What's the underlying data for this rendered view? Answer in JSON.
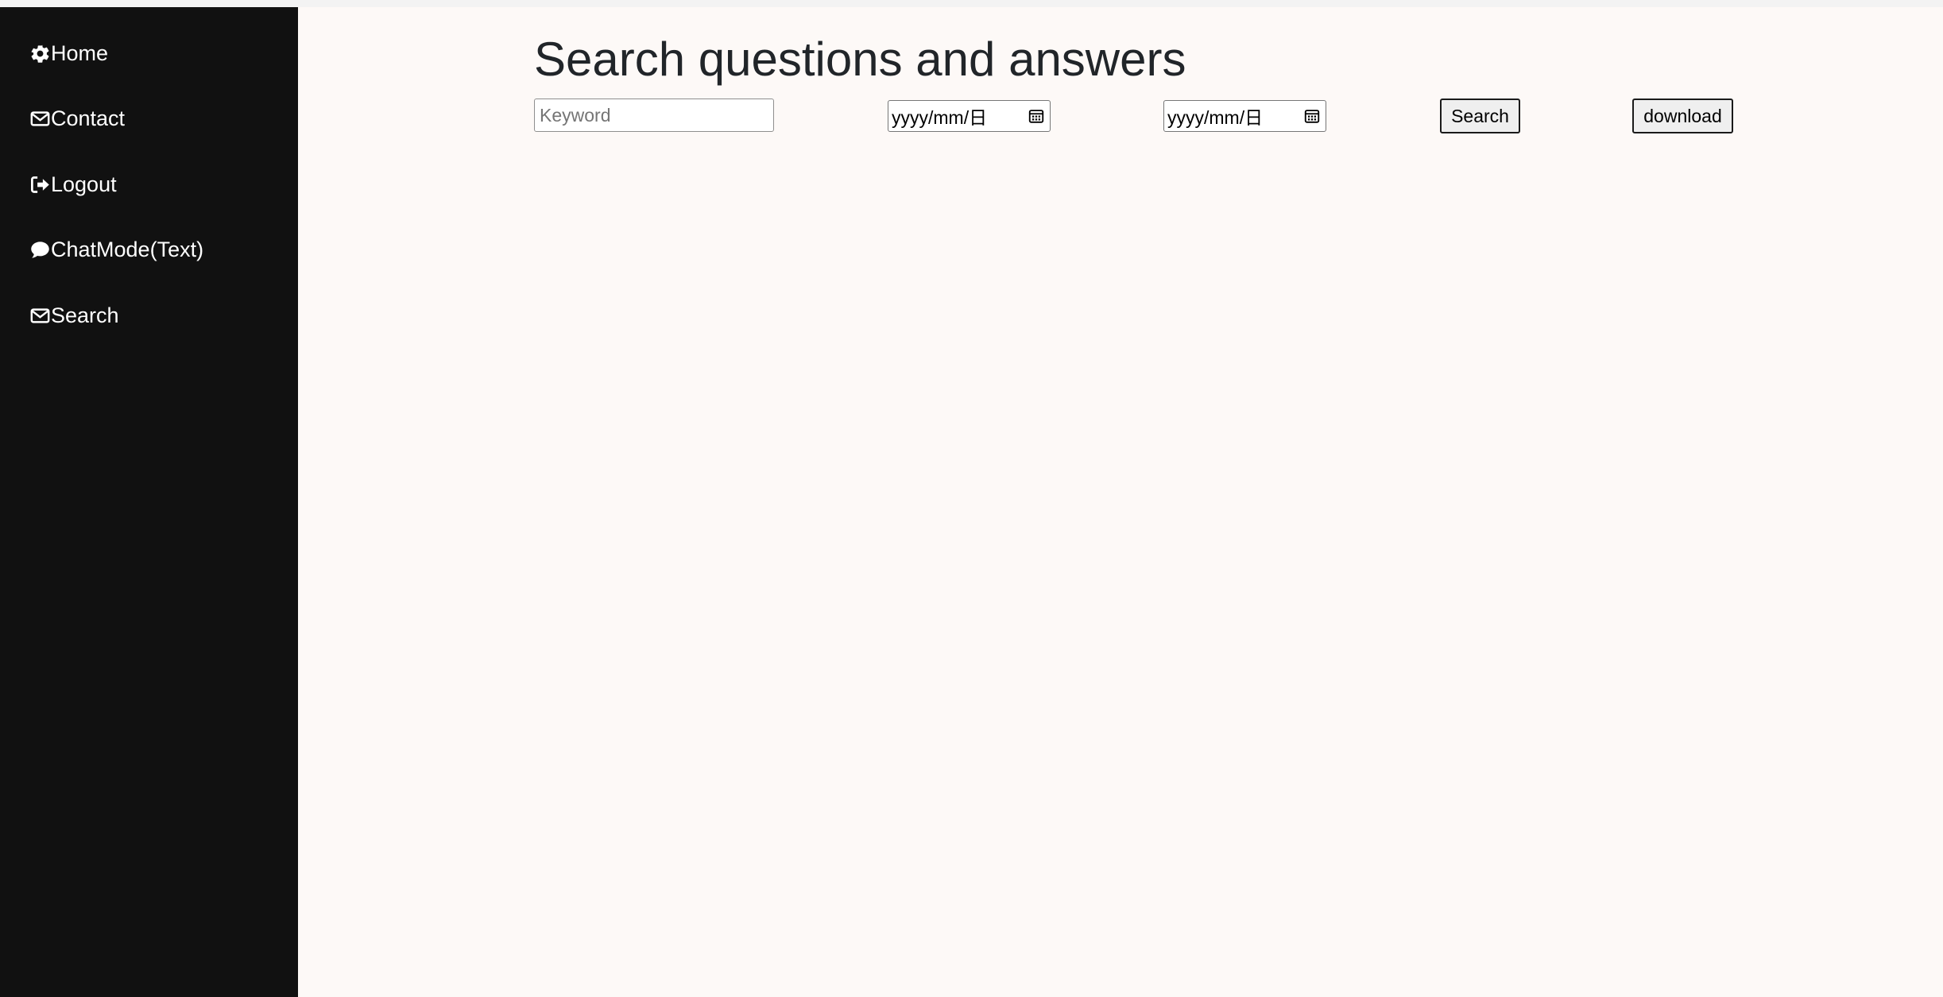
{
  "sidebar": {
    "items": [
      {
        "label": "Home",
        "icon": "gear-icon"
      },
      {
        "label": "Contact",
        "icon": "envelope-icon"
      },
      {
        "label": "Logout",
        "icon": "sign-out-icon"
      },
      {
        "label": "ChatMode(Text)",
        "icon": "comment-icon"
      },
      {
        "label": "Search",
        "icon": "envelope-icon"
      }
    ]
  },
  "main": {
    "title": "Search questions and answers",
    "keyword": {
      "placeholder": "Keyword",
      "value": ""
    },
    "start_date": {
      "display": "yyyy/mm/日"
    },
    "end_date": {
      "display": "yyyy/mm/日"
    },
    "search_label": "Search",
    "download_label": "download"
  },
  "colors": {
    "sidebar_bg": "#111111",
    "page_bg": "#fdf9f7",
    "title_text": "#212529"
  }
}
